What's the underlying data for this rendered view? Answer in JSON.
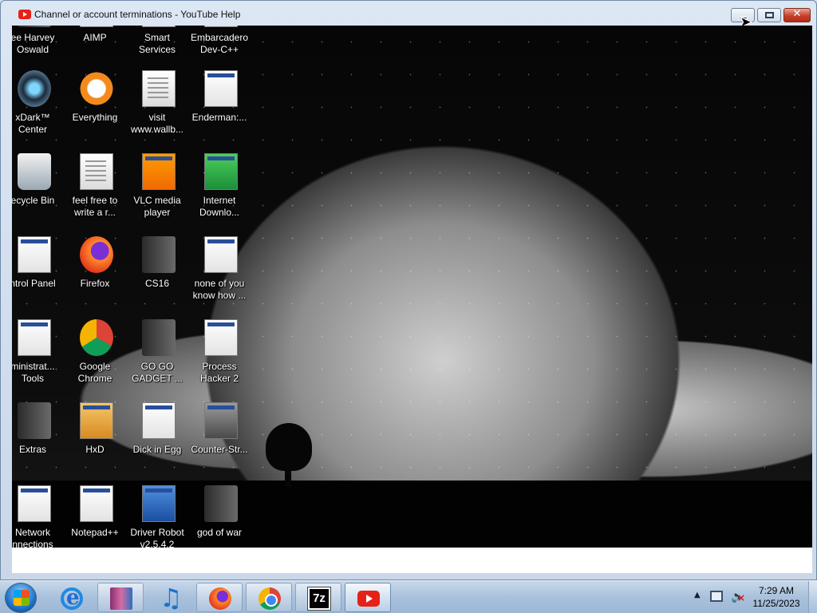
{
  "window": {
    "title": "Channel or account terminations - YouTube Help",
    "close_glyph": "✕"
  },
  "desktop": {
    "icons": [
      {
        "label": "ee Harvey\nOswald",
        "icon": "folder-icon"
      },
      {
        "label": "AIMP",
        "icon": "aimp-icon"
      },
      {
        "label": "Smart\nServices",
        "icon": "app-icon"
      },
      {
        "label": "Embarcadero\nDev-C++",
        "icon": "devcpp-icon"
      },
      {
        "label": "xDark™\nCenter",
        "icon": "xdark-icon"
      },
      {
        "label": "Everything",
        "icon": "everything-icon"
      },
      {
        "label": "visit\nwww.wallb...",
        "icon": "text-file-icon"
      },
      {
        "label": "Enderman:...",
        "icon": "app-icon"
      },
      {
        "label": "ecycle Bin",
        "icon": "recycle-bin-icon"
      },
      {
        "label": "feel free to\nwrite a r...",
        "icon": "text-file-icon"
      },
      {
        "label": "VLC media\nplayer",
        "icon": "vlc-icon"
      },
      {
        "label": "Internet\nDownlo...",
        "icon": "internet-download-icon"
      },
      {
        "label": "ntrol Panel",
        "icon": "control-panel-icon"
      },
      {
        "label": "Firefox",
        "icon": "firefox-icon"
      },
      {
        "label": "CS16",
        "icon": "folder-icon"
      },
      {
        "label": "none of you\nknow how ...",
        "icon": "app-icon"
      },
      {
        "label": "ministrat...\nTools",
        "icon": "admin-tools-icon"
      },
      {
        "label": "Google\nChrome",
        "icon": "chrome-icon"
      },
      {
        "label": "GO GO\nGADGET ...",
        "icon": "folder-icon"
      },
      {
        "label": "Process\nHacker 2",
        "icon": "process-hacker-icon"
      },
      {
        "label": "Extras",
        "icon": "folder-icon"
      },
      {
        "label": "HxD",
        "icon": "hxd-icon"
      },
      {
        "label": "Dick in Egg",
        "icon": "app-icon"
      },
      {
        "label": "Counter-Str...",
        "icon": "counter-strike-icon"
      },
      {
        "label": "Network\nnnections",
        "icon": "network-connections-icon"
      },
      {
        "label": "Notepad++",
        "icon": "notepadpp-icon"
      },
      {
        "label": "Driver Robot\nv2.5.4.2",
        "icon": "driver-robot-icon"
      },
      {
        "label": "god of war",
        "icon": "folder-icon"
      }
    ]
  },
  "taskbar": {
    "items": [
      {
        "name": "internet-explorer",
        "icon": "internet-explorer-icon"
      },
      {
        "name": "winrar",
        "icon": "winrar-icon"
      },
      {
        "name": "music-player",
        "icon": "music-icon"
      },
      {
        "name": "firefox",
        "icon": "firefox-icon"
      },
      {
        "name": "chrome",
        "icon": "chrome-icon"
      },
      {
        "name": "7-zip",
        "icon": "7zip-icon",
        "text": "7z"
      },
      {
        "name": "youtube",
        "icon": "youtube-icon",
        "active": true
      }
    ],
    "tray": {
      "time": "7:29 AM",
      "date": "11/25/2023",
      "chevron": "▲"
    }
  },
  "colors": {
    "youtube_red": "#e62117",
    "taskbar": "#a9c1dc",
    "close_button": "#c7402c"
  }
}
